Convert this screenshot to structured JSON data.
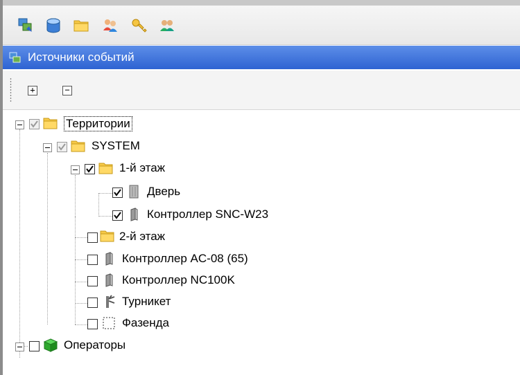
{
  "toolbar": {
    "buttons": [
      {
        "icon": "event-sources-icon"
      },
      {
        "icon": "database-icon"
      },
      {
        "icon": "folder-icon"
      },
      {
        "icon": "users-icon"
      },
      {
        "icon": "key-icon"
      },
      {
        "icon": "operators-icon"
      }
    ]
  },
  "panel": {
    "title": "Источники событий",
    "expand_all_label": "+",
    "collapse_all_label": "−"
  },
  "tree": [
    {
      "label": "Территории",
      "checked": "partial",
      "icon": "folder-icon",
      "selected": true
    },
    {
      "label": "SYSTEM",
      "checked": "partial",
      "icon": "folder-icon"
    },
    {
      "label": "1-й этаж",
      "checked": "checked",
      "icon": "folder-icon"
    },
    {
      "label": "Дверь",
      "checked": "checked",
      "icon": "door-icon"
    },
    {
      "label": "Контроллер SNC-W23",
      "checked": "checked",
      "icon": "controller-icon"
    },
    {
      "label": "2-й этаж",
      "checked": "unchecked",
      "icon": "folder-icon"
    },
    {
      "label": "Контроллер AC-08 (65)",
      "checked": "unchecked",
      "icon": "controller-icon"
    },
    {
      "label": "Контроллер NC100K",
      "checked": "unchecked",
      "icon": "controller-icon"
    },
    {
      "label": "Турникет",
      "checked": "unchecked",
      "icon": "turnstile-icon"
    },
    {
      "label": "Фазенда",
      "checked": "unchecked",
      "icon": "zone-icon"
    },
    {
      "label": "Операторы",
      "checked": "unchecked",
      "icon": "cube-icon"
    }
  ],
  "colors": {
    "caption_top": "#5d8ee8",
    "caption_bottom": "#2e63d2",
    "folder": "#f7c948"
  }
}
